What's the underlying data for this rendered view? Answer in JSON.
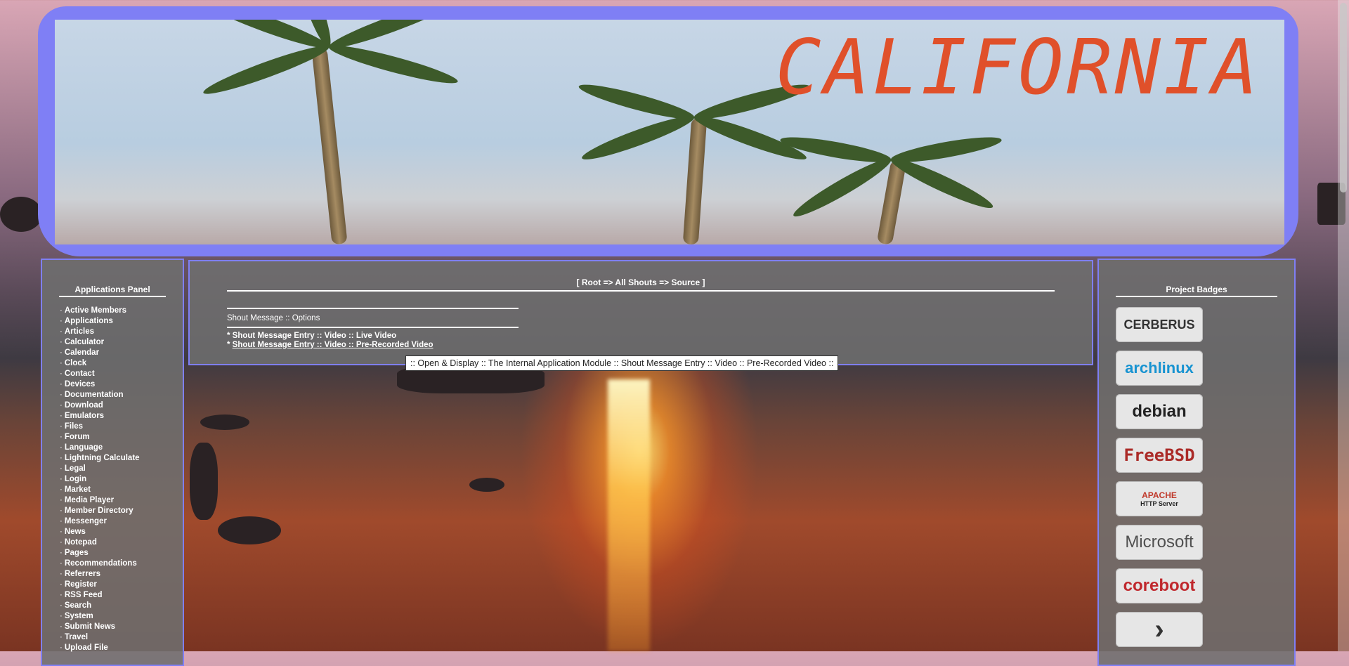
{
  "header": {
    "title": "CALIFORNIA"
  },
  "left_panel": {
    "title": "Applications Panel",
    "items": [
      "Active Members",
      "Applications",
      "Articles",
      "Calculator",
      "Calendar",
      "Clock",
      "Contact",
      "Devices",
      "Documentation",
      "Download",
      "Emulators",
      "Files",
      "Forum",
      "Language",
      "Lightning Calculate",
      "Legal",
      "Login",
      "Market",
      "Media Player",
      "Member Directory",
      "Messenger",
      "News",
      "Notepad",
      "Pages",
      "Recommendations",
      "Referrers",
      "Register",
      "RSS Feed",
      "Search",
      "System",
      "Submit News",
      "Travel",
      "Upload File"
    ]
  },
  "center": {
    "breadcrumb": "[ Root => All Shouts => Source ]",
    "section_title": "Shout Message :: Options",
    "option_1": "* Shout Message Entry :: Video :: Live Video",
    "option_2_prefix": "* ",
    "option_2_link": "Shout Message Entry :: Video :: Pre-Recorded Video",
    "tooltip": ":: Open & Display :: The Internal Application Module :: Shout Message Entry :: Video :: Pre-Recorded Video ::"
  },
  "right_panel": {
    "title": "Project Badges",
    "badges": [
      {
        "label": "CERBERUS",
        "color": "#333333"
      },
      {
        "label": "archlinux",
        "color": "#1793d1"
      },
      {
        "label": "debian",
        "color": "#222222"
      },
      {
        "label": "FreeBSD",
        "color": "#ab2b28"
      },
      {
        "label": "APACHE",
        "sub": "HTTP Server",
        "color": "#c0392b"
      },
      {
        "label": "Microsoft",
        "color": "#505050"
      },
      {
        "label": "coreboot",
        "color": "#c0282d"
      },
      {
        "label": "",
        "color": "#333333"
      }
    ]
  }
}
